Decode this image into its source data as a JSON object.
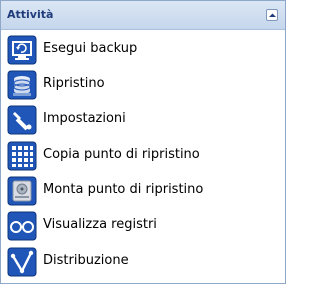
{
  "panel": {
    "title": "Attività",
    "collapse_icon": "chevron-up-icon"
  },
  "items": [
    {
      "label": "Esegui backup",
      "icon": "backup-icon"
    },
    {
      "label": "Ripristino",
      "icon": "restore-icon"
    },
    {
      "label": "Impostazioni",
      "icon": "wrench-icon"
    },
    {
      "label": "Copia punto di ripristino",
      "icon": "copy-grid-icon"
    },
    {
      "label": "Monta punto di ripristino",
      "icon": "drive-icon"
    },
    {
      "label": "Visualizza registri",
      "icon": "glasses-icon"
    },
    {
      "label": "Distribuzione",
      "icon": "distribution-icon"
    }
  ],
  "colors": {
    "icon_blue": "#1f56b8",
    "header_text": "#1f3d7a"
  }
}
